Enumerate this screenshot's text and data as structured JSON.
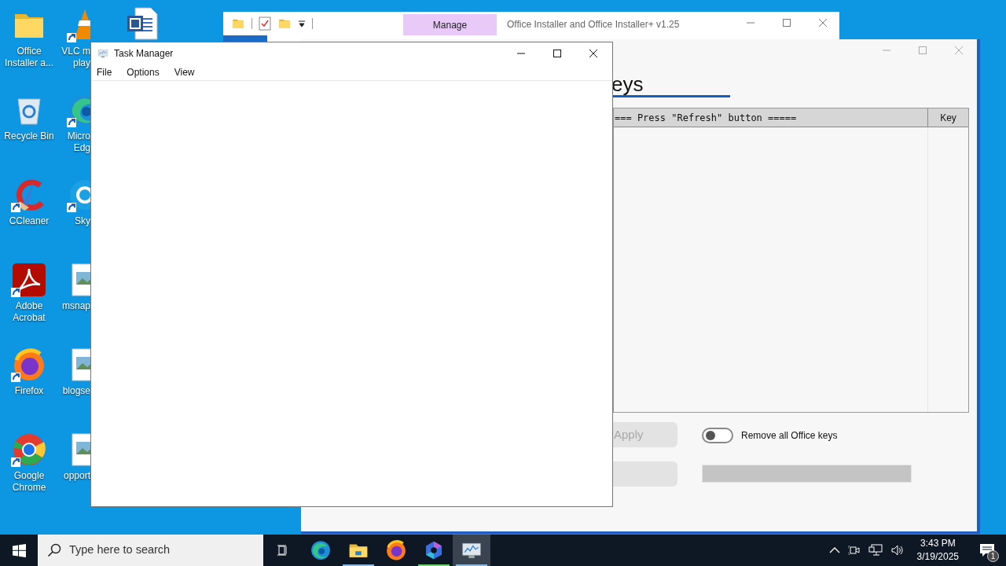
{
  "desktop_icons": [
    {
      "label": "Office Installer a...",
      "kind": "folder",
      "shortcut": false
    },
    {
      "label": "Recycle Bin",
      "kind": "recycle",
      "shortcut": false
    },
    {
      "label": "CCleaner",
      "kind": "ccleaner",
      "shortcut": true
    },
    {
      "label": "Adobe Acrobat",
      "kind": "acrobat",
      "shortcut": true
    },
    {
      "label": "Firefox",
      "kind": "firefox",
      "shortcut": true
    },
    {
      "label": "Google Chrome",
      "kind": "chrome",
      "shortcut": true
    }
  ],
  "covered_icons": [
    {
      "lines": [
        "VLC m",
        "play"
      ],
      "kind": "vlc",
      "shortcut": true
    },
    {
      "lines": [
        "Micro",
        "Edg"
      ],
      "kind": "edge",
      "shortcut": true
    },
    {
      "lines": [
        "Sky"
      ],
      "kind": "skype",
      "shortcut": true
    },
    {
      "lines": [
        "msnap"
      ],
      "kind": "image",
      "shortcut": false
    },
    {
      "lines": [
        "blogse"
      ],
      "kind": "image",
      "shortcut": false
    },
    {
      "lines": [
        "opport"
      ],
      "kind": "image",
      "shortcut": false
    }
  ],
  "hidden_label_icons": [
    {
      "kind": "word",
      "shortcut": false
    }
  ],
  "explorer_window": {
    "title": "Office Installer and Office Installer+ v1.25",
    "context_tab": "Manage"
  },
  "installer_window": {
    "heading": "eys",
    "table": {
      "columns": [
        "=== Press \"Refresh\" button =====",
        "Key"
      ]
    },
    "apply_button": {
      "label": "Apply",
      "disabled": true
    },
    "toggle": {
      "label": "Remove all Office keys",
      "on": false
    },
    "progress": {
      "level": 0
    }
  },
  "task_manager": {
    "title": "Task Manager",
    "menu": [
      "File",
      "Options",
      "View"
    ]
  },
  "taskbar": {
    "search_placeholder": "Type here to search",
    "apps": [
      {
        "kind": "taskview",
        "running": false,
        "selected": false
      },
      {
        "kind": "edge",
        "running": false,
        "selected": false
      },
      {
        "kind": "explorer",
        "running": true,
        "selected": false
      },
      {
        "kind": "firefox",
        "running": false,
        "selected": false
      },
      {
        "kind": "copilot",
        "running": true,
        "selected": false
      },
      {
        "kind": "taskmgr",
        "running": true,
        "selected": true
      }
    ],
    "time": "3:43 PM",
    "date": "3/19/2025",
    "notification_count": "1"
  }
}
